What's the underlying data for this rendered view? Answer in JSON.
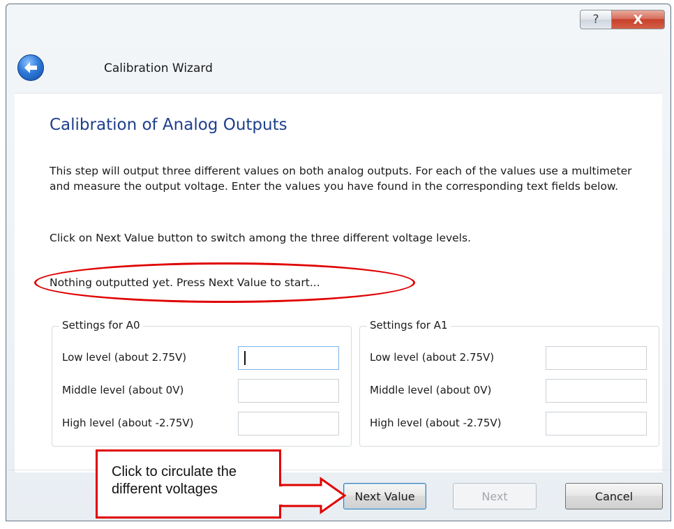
{
  "titlebar": {
    "help_icon": "?",
    "close_icon": "X"
  },
  "header": {
    "back_icon": "back-arrow-icon",
    "title": "Calibration Wizard"
  },
  "main": {
    "heading": "Calibration of Analog Outputs",
    "description": "This step will output three different values on both analog outputs. For each of the values use a multimeter and measure the output voltage. Enter the values you have found in the corresponding text fields below.",
    "instruction": "Click on Next Value button to switch among the three different voltage levels.",
    "status": "Nothing outputted yet. Press Next Value to start..."
  },
  "groups": [
    {
      "legend": "Settings for A0",
      "rows": [
        {
          "label": "Low level (about 2.75V)",
          "value": ""
        },
        {
          "label": "Middle level (about 0V)",
          "value": ""
        },
        {
          "label": "High level (about -2.75V)",
          "value": ""
        }
      ]
    },
    {
      "legend": "Settings for A1",
      "rows": [
        {
          "label": "Low level (about 2.75V)",
          "value": ""
        },
        {
          "label": "Middle level (about 0V)",
          "value": ""
        },
        {
          "label": "High level (about -2.75V)",
          "value": ""
        }
      ]
    }
  ],
  "footer": {
    "next_value_label": "Next Value",
    "next_label": "Next",
    "cancel_label": "Cancel"
  },
  "annotation": {
    "callout_text": "Click to circulate the different voltages",
    "color": "#e00000"
  }
}
